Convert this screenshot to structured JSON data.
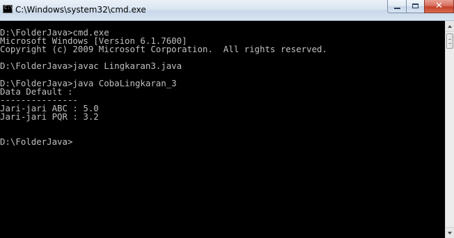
{
  "window": {
    "title": "C:\\Windows\\system32\\cmd.exe",
    "icon": "cmd-console-icon",
    "controls": {
      "minimize": "minimize-icon",
      "maximize": "maximize-icon",
      "close": "close-icon",
      "close_glyph": "✕"
    }
  },
  "console": {
    "background": "#000000",
    "foreground": "#c0c0c0",
    "lines": [
      "D:\\FolderJava>cmd.exe",
      "Microsoft Windows [Version 6.1.7600]",
      "Copyright (c) 2009 Microsoft Corporation.  All rights reserved.",
      "",
      "D:\\FolderJava>javac Lingkaran3.java",
      "",
      "D:\\FolderJava>java CobaLingkaran_3",
      "Data Default :",
      "---------------",
      "Jari-jari ABC : 5.0",
      "Jari-jari PQR : 3.2",
      "",
      "",
      "D:\\FolderJava>"
    ]
  },
  "scrollbar": {
    "up_icon": "scroll-up-arrow-icon",
    "down_icon": "scroll-down-arrow-icon"
  }
}
